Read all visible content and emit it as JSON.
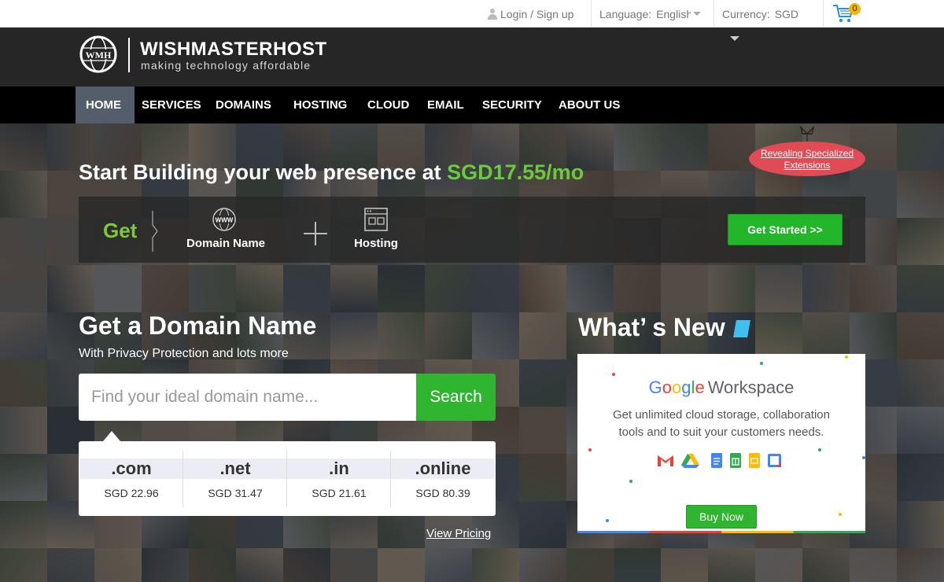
{
  "topbar": {
    "login": "Login / Sign up",
    "language_label": "Language:",
    "language_value": "English",
    "currency_label": "Currency:",
    "currency_value": "SGD",
    "cart_count": "0"
  },
  "logo": {
    "name": "WISHMASTERHOST",
    "tagline": "making technology affordable",
    "monogram": "WMH"
  },
  "nav": {
    "items": [
      "HOME",
      "SERVICES",
      "DOMAINS",
      "HOSTING",
      "CLOUD",
      "EMAIL",
      "SECURITY",
      "ABOUT US"
    ],
    "active": "HOME"
  },
  "hero": {
    "headline_prefix": "Start Building your web presence at ",
    "headline_price": "SGD17.55/mo",
    "ribbon_line1": "Revealing Specialized",
    "ribbon_line2": "Extensions",
    "get_label": "Get",
    "domain_label": "Domain Name",
    "domain_icon_text": "WWW",
    "hosting_label": "Hosting",
    "get_started": "Get Started >>"
  },
  "domain_search": {
    "title": "Get a Domain Name",
    "subtitle": "With Privacy Protection and lots more",
    "placeholder": "Find your ideal domain name...",
    "button": "Search",
    "tlds": [
      {
        "name": ".com",
        "price": "SGD 22.96"
      },
      {
        "name": ".net",
        "price": "SGD 31.47"
      },
      {
        "name": ".in",
        "price": "SGD 21.61"
      },
      {
        "name": ".online",
        "price": "SGD 80.39"
      }
    ],
    "view_pricing": "View Pricing"
  },
  "whats_new": {
    "title": "What’  s New",
    "brand_letters": [
      "G",
      "o",
      "o",
      "g",
      "l",
      "e"
    ],
    "brand_colors": [
      "#4285f4",
      "#ea4335",
      "#fbbc05",
      "#4285f4",
      "#34a853",
      "#ea4335"
    ],
    "product": "Workspace",
    "text": "Get unlimited cloud storage, collaboration tools and to suit your customers needs.",
    "buy_now": "Buy Now"
  },
  "colors": {
    "accent_green": "#6ac93c",
    "button_green": "#2fb52f",
    "nav_active": "#545e6a",
    "ribbon_red": "#e04b55"
  }
}
